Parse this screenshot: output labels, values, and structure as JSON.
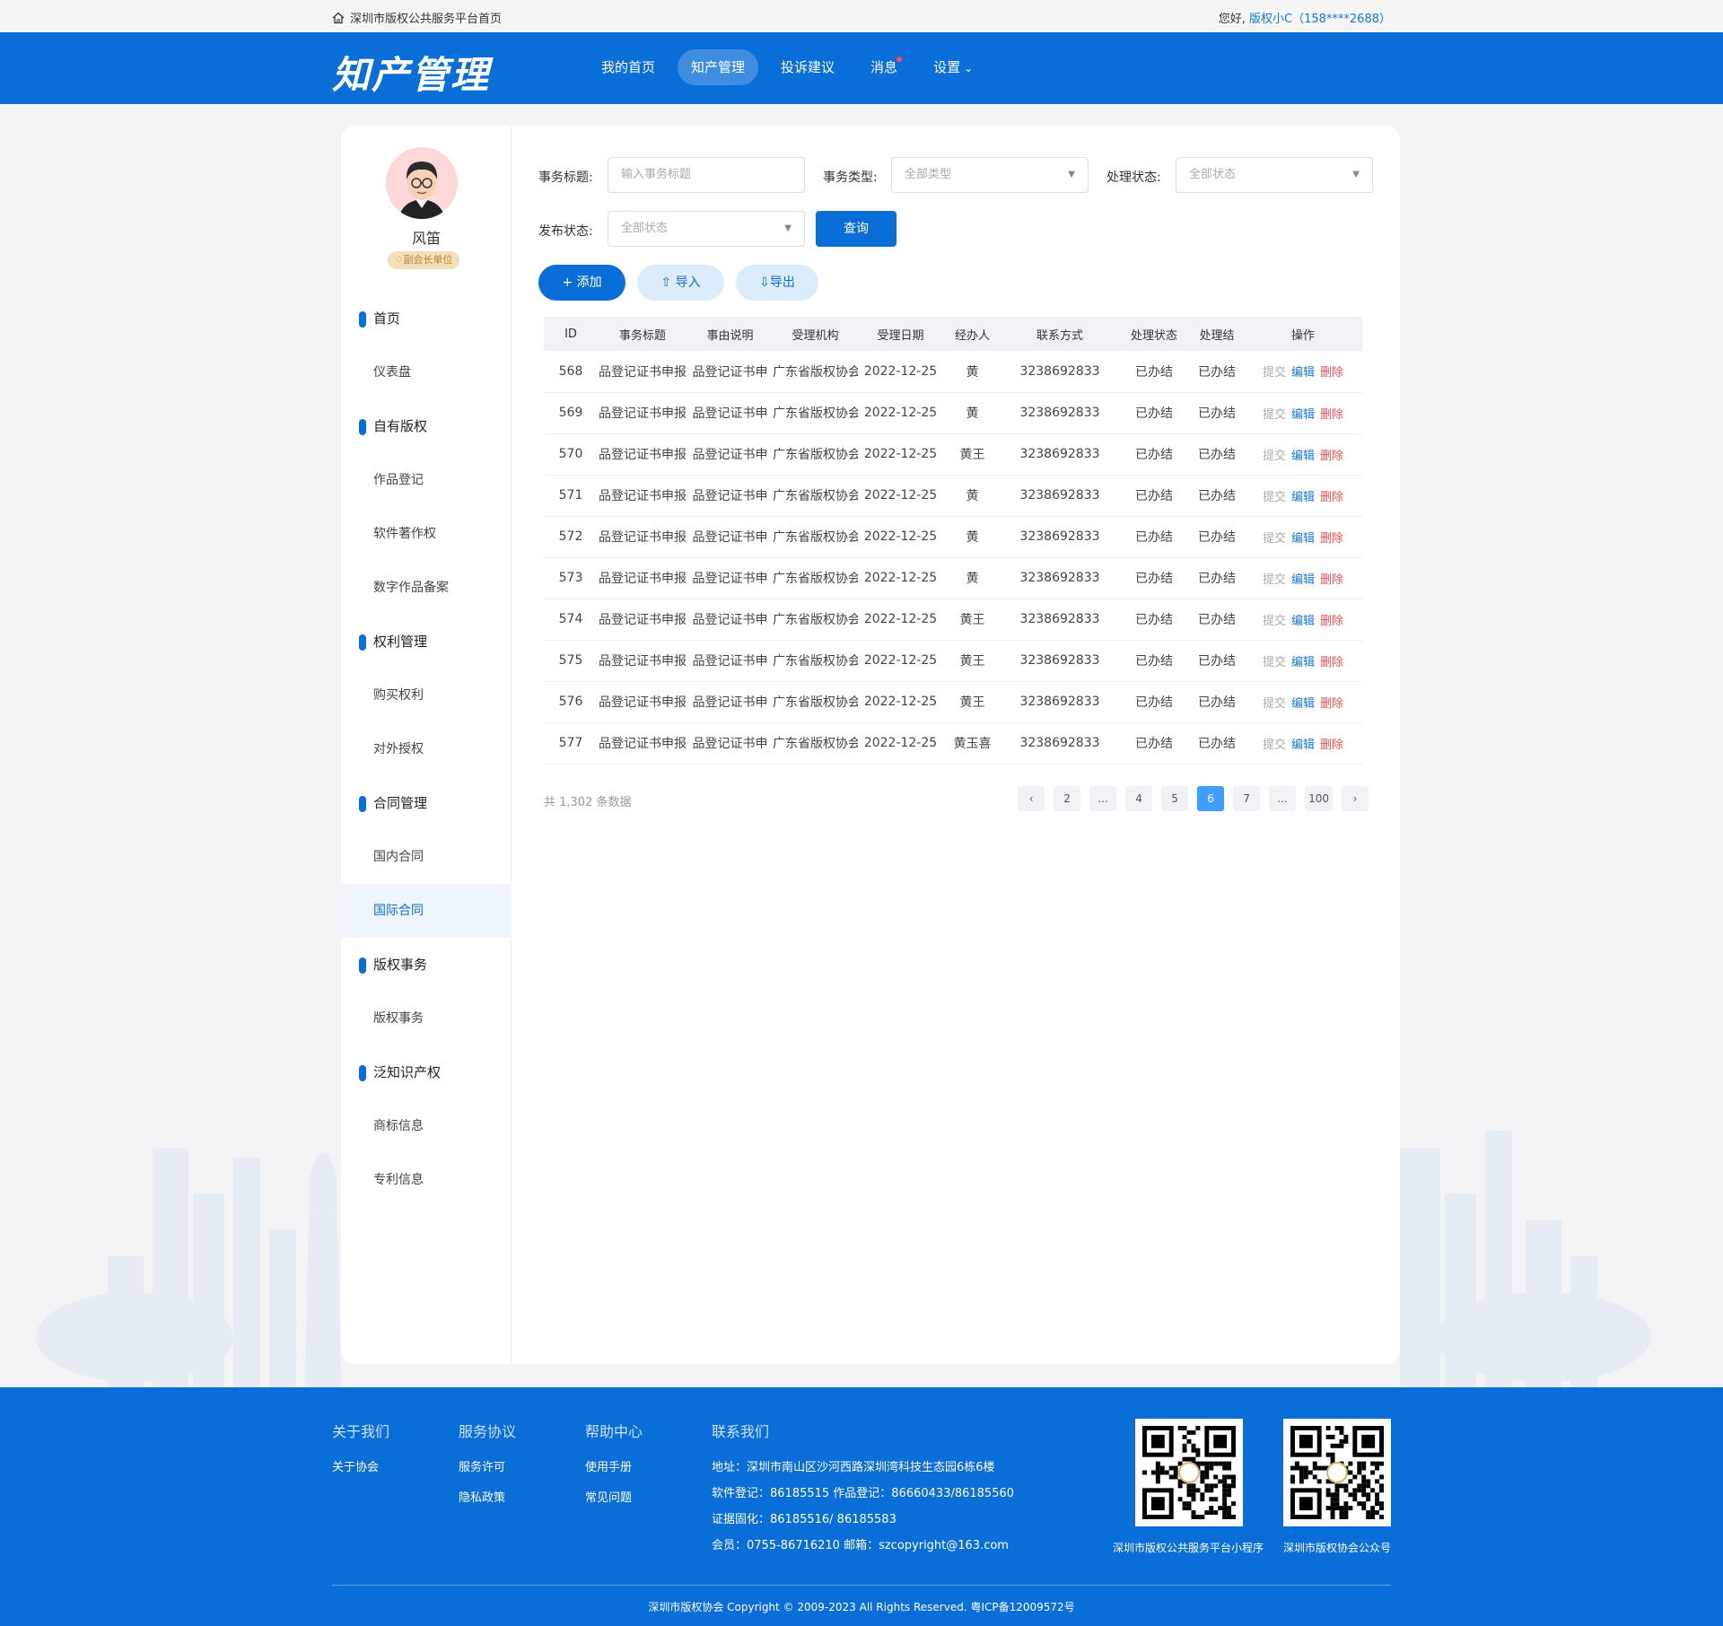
{
  "topbar": {
    "home_link": "深圳市版权公共服务平台首页",
    "greeting": "您好,",
    "user": "版权小C（158****2688）"
  },
  "header": {
    "logo": "知产管理",
    "nav": [
      {
        "label": "我的首页",
        "active": false
      },
      {
        "label": "知产管理",
        "active": true
      },
      {
        "label": "投诉建议",
        "active": false
      },
      {
        "label": "消息",
        "active": false
      },
      {
        "label": "设置",
        "active": false
      }
    ]
  },
  "profile": {
    "name": "风笛",
    "badge": "副会长单位"
  },
  "sidebar": {
    "groups": [
      {
        "label": "首页",
        "items": [
          "仪表盘"
        ]
      },
      {
        "label": "自有版权",
        "items": [
          "作品登记",
          "软件著作权",
          "数字作品备案"
        ]
      },
      {
        "label": "权利管理",
        "items": [
          "购买权利",
          "对外授权"
        ]
      },
      {
        "label": "合同管理",
        "items": [
          "国内合同",
          "国际合同"
        ]
      },
      {
        "label": "版权事务",
        "items": [
          "版权事务"
        ]
      },
      {
        "label": "泛知识产权",
        "items": [
          "商标信息",
          "专利信息"
        ]
      }
    ],
    "active_item": "国际合同"
  },
  "filters": {
    "title_label": "事务标题:",
    "title_placeholder": "输入事务标题",
    "type_label": "事务类型:",
    "type_value": "全部类型",
    "status_label": "处理状态:",
    "status_value": "全部状态",
    "publish_label": "发布状态:",
    "publish_value": "全部状态",
    "query_button": "查询"
  },
  "actions": {
    "add": "添加",
    "import": "导入",
    "export": "导出"
  },
  "table": {
    "columns": [
      "ID",
      "事务标题",
      "事由说明",
      "受理机构",
      "受理日期",
      "经办人",
      "联系方式",
      "处理状态",
      "处理结",
      "操作"
    ],
    "rows": [
      {
        "id": "568",
        "title": "品登记证书申报",
        "reason": "品登记证书申",
        "org": "广东省版权协会",
        "date": "2022-12-25",
        "handler": "黄",
        "phone": "3238692833",
        "status": "已办结",
        "result": "已办结"
      },
      {
        "id": "569",
        "title": "品登记证书申报",
        "reason": "品登记证书申",
        "org": "广东省版权协会",
        "date": "2022-12-25",
        "handler": "黄",
        "phone": "3238692833",
        "status": "已办结",
        "result": "已办结"
      },
      {
        "id": "570",
        "title": "品登记证书申报",
        "reason": "品登记证书申",
        "org": "广东省版权协会",
        "date": "2022-12-25",
        "handler": "黄王",
        "phone": "3238692833",
        "status": "已办结",
        "result": "已办结"
      },
      {
        "id": "571",
        "title": "品登记证书申报",
        "reason": "品登记证书申",
        "org": "广东省版权协会",
        "date": "2022-12-25",
        "handler": "黄",
        "phone": "3238692833",
        "status": "已办结",
        "result": "已办结"
      },
      {
        "id": "572",
        "title": "品登记证书申报",
        "reason": "品登记证书申",
        "org": "广东省版权协会",
        "date": "2022-12-25",
        "handler": "黄",
        "phone": "3238692833",
        "status": "已办结",
        "result": "已办结"
      },
      {
        "id": "573",
        "title": "品登记证书申报",
        "reason": "品登记证书申",
        "org": "广东省版权协会",
        "date": "2022-12-25",
        "handler": "黄",
        "phone": "3238692833",
        "status": "已办结",
        "result": "已办结"
      },
      {
        "id": "574",
        "title": "品登记证书申报",
        "reason": "品登记证书申",
        "org": "广东省版权协会",
        "date": "2022-12-25",
        "handler": "黄王",
        "phone": "3238692833",
        "status": "已办结",
        "result": "已办结"
      },
      {
        "id": "575",
        "title": "品登记证书申报",
        "reason": "品登记证书申",
        "org": "广东省版权协会",
        "date": "2022-12-25",
        "handler": "黄王",
        "phone": "3238692833",
        "status": "已办结",
        "result": "已办结"
      },
      {
        "id": "576",
        "title": "品登记证书申报",
        "reason": "品登记证书申",
        "org": "广东省版权协会",
        "date": "2022-12-25",
        "handler": "黄王",
        "phone": "3238692833",
        "status": "已办结",
        "result": "已办结"
      },
      {
        "id": "577",
        "title": "品登记证书申报",
        "reason": "品登记证书申",
        "org": "广东省版权协会",
        "date": "2022-12-25",
        "handler": "黄玉喜",
        "phone": "3238692833",
        "status": "已办结",
        "result": "已办结"
      }
    ],
    "ops": {
      "submit": "提交",
      "edit": "编辑",
      "delete": "删除"
    }
  },
  "pagination": {
    "total": "共 1,302 条数据",
    "pages": [
      "2",
      "...",
      "4",
      "5",
      "6",
      "7",
      "...",
      "100"
    ],
    "current": "6"
  },
  "footer": {
    "columns": [
      {
        "title": "关于我们",
        "links": [
          "关于协会"
        ]
      },
      {
        "title": "服务协议",
        "links": [
          "服务许可",
          "隐私政策"
        ]
      },
      {
        "title": "帮助中心",
        "links": [
          "使用手册",
          "常见问题"
        ]
      }
    ],
    "contact_title": "联系我们",
    "contact_lines": [
      "地址：深圳市南山区沙河西路深圳湾科技生态园6栋6楼",
      "软件登记：86185515  作品登记：86660433/86185560",
      "证据固化：86185516/ 86185583",
      "会员：0755-86716210  邮箱：szcopyright@163.com"
    ],
    "qr_labels": [
      "深圳市版权公共服务平台小程序",
      "深圳市版权协会公众号"
    ],
    "copyright": "深圳市版权协会 Copyright © 2009-2023 All Rights Reserved.   粤ICP备12009572号"
  },
  "colors": {
    "brand": "#0a6ed8",
    "danger": "#ff4d4f",
    "page_active": "#409eff"
  }
}
